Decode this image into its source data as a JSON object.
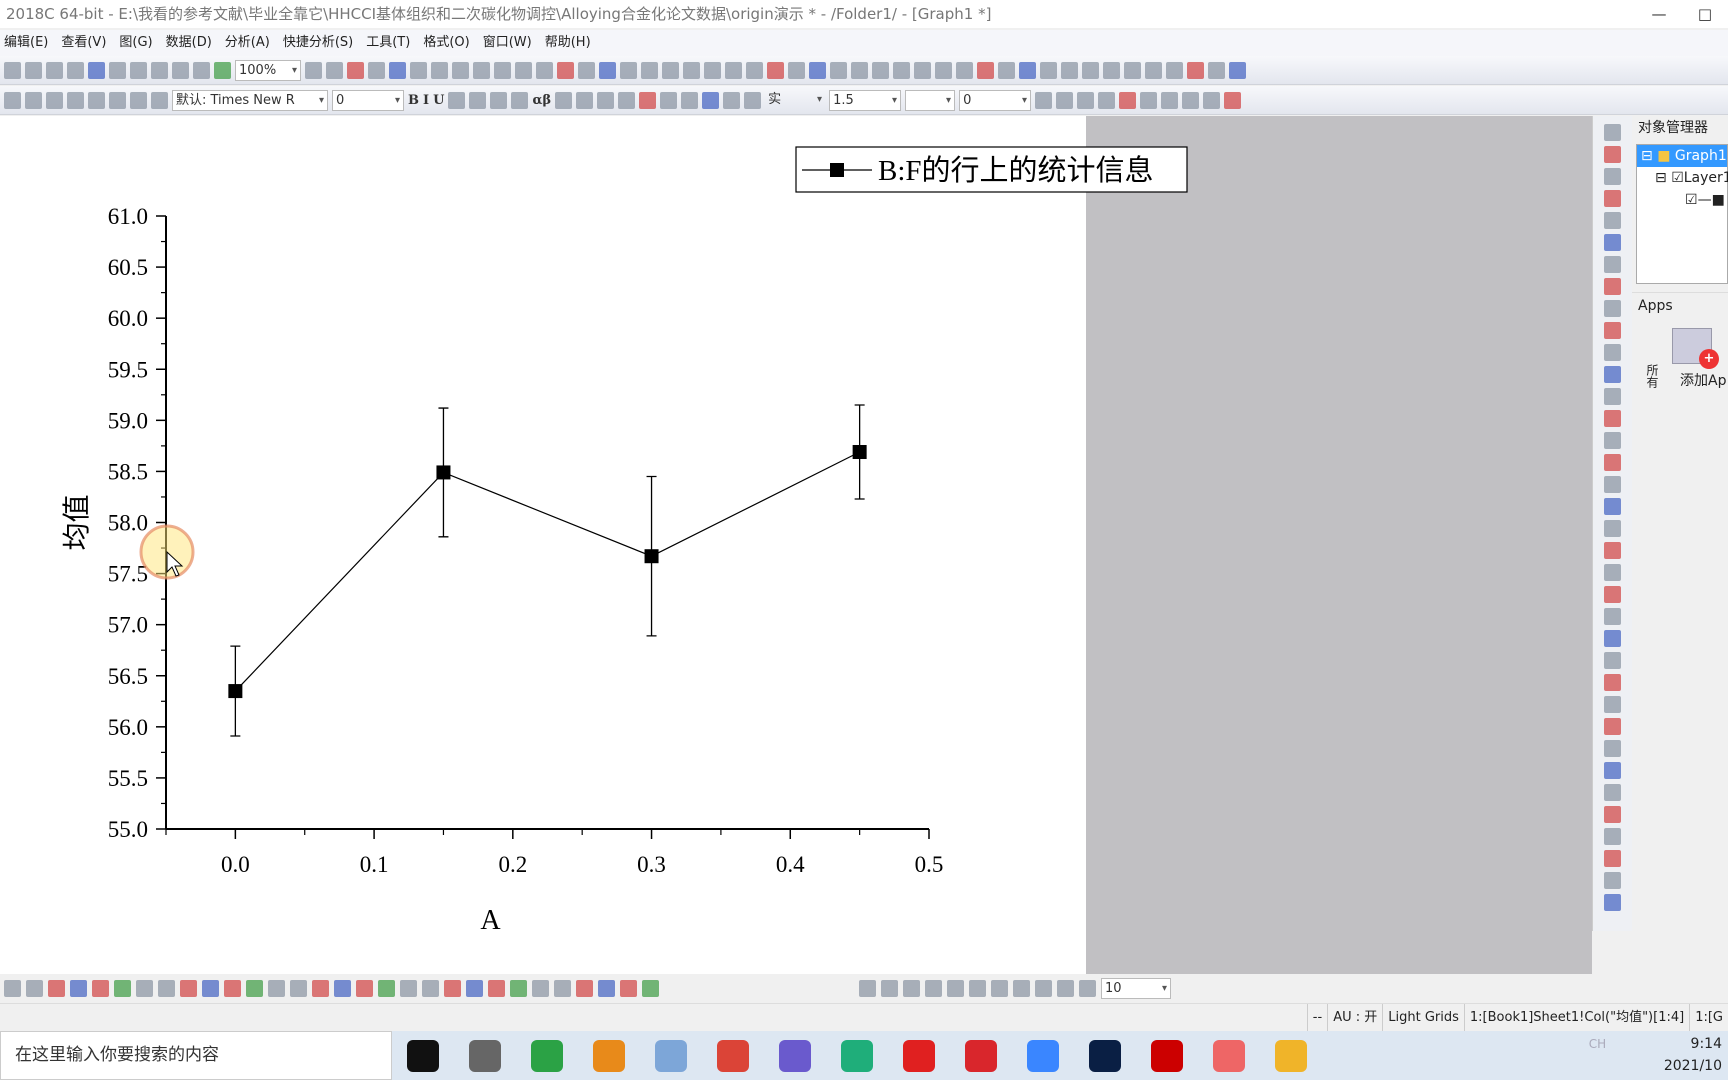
{
  "window": {
    "title": "2018C 64-bit - E:\\我看的参考文献\\毕业全靠它\\HHCCI基体组织和二次碳化物调控\\Alloying合金化论文数据\\origin演示 * - /Folder1/ - [Graph1 *]",
    "min": "—",
    "max": "□"
  },
  "menu": [
    "编辑(E)",
    "查看(V)",
    "图(G)",
    "数据(D)",
    "分析(A)",
    "快捷分析(S)",
    "工具(T)",
    "格式(O)",
    "窗口(W)",
    "帮助(H)"
  ],
  "toolbar": {
    "zoom": "100%",
    "font": "默认: Times New R",
    "font_size": "0",
    "bold": "B",
    "italic": "I",
    "underline": "U",
    "greek": "αβ",
    "line_style": "实",
    "line_width": "1.5",
    "value2": "0",
    "bottom_value": "10"
  },
  "object_manager": {
    "title": "对象管理器",
    "graph": "Graph1",
    "layer": "Layer1"
  },
  "apps": {
    "title": "Apps",
    "add": "添加Ap",
    "tab": "所有"
  },
  "status": [
    "--",
    "AU : 开",
    "Light Grids",
    "1:[Book1]Sheet1!Col(\"均值\")[1:4]",
    "1:[G"
  ],
  "taskbar": {
    "search_placeholder": "在这里输入你要搜索的内容",
    "time": "9:14",
    "date": "2021/10",
    "ime": "CH"
  },
  "chart_data": {
    "type": "line",
    "xlabel": "A",
    "ylabel": "均值",
    "xlim": [
      -0.05,
      0.5
    ],
    "ylim": [
      55.0,
      61.0
    ],
    "xticks": [
      "0.0",
      "0.1",
      "0.2",
      "0.3",
      "0.4",
      "0.5"
    ],
    "yticks": [
      "55.0",
      "55.5",
      "56.0",
      "56.5",
      "57.0",
      "57.5",
      "58.0",
      "58.5",
      "59.0",
      "59.5",
      "60.0",
      "60.5",
      "61.0"
    ],
    "legend": "top-right",
    "grid": false,
    "series": [
      {
        "name": "B:F的行上的统计信息",
        "x": [
          0.0,
          0.15,
          0.3,
          0.45
        ],
        "y": [
          56.35,
          58.49,
          57.67,
          58.69
        ],
        "error": [
          0.44,
          0.63,
          0.78,
          0.46
        ],
        "marker": "square",
        "color": "#000000"
      }
    ]
  }
}
